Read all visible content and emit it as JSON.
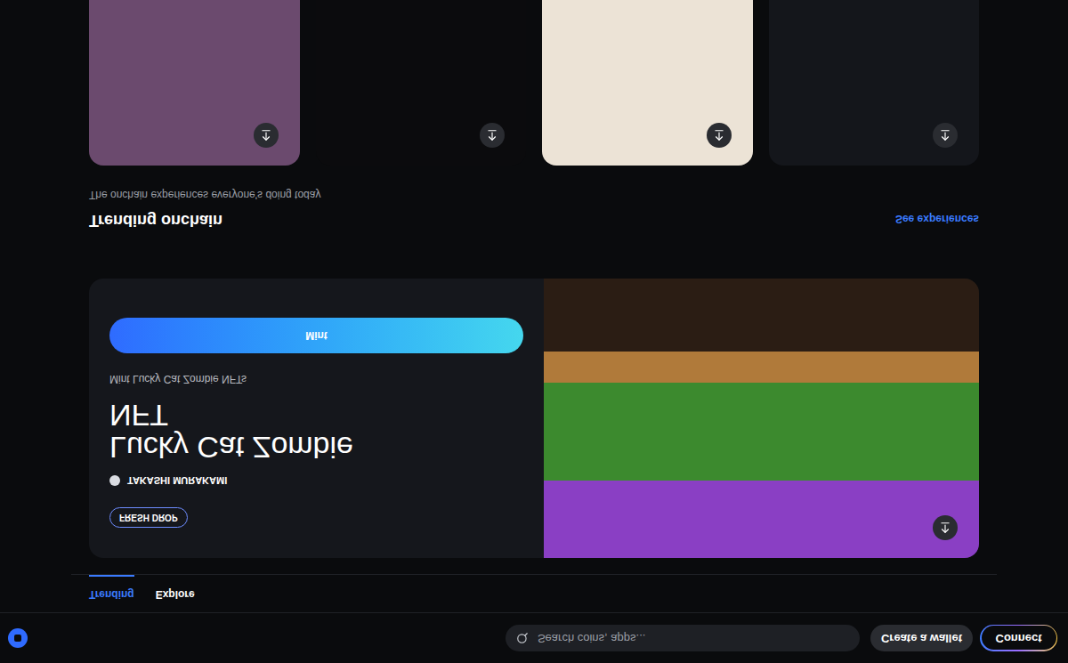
{
  "header": {
    "search_placeholder": "Search coins, apps...",
    "buttons": [
      "Create a wallet",
      "Connect"
    ]
  },
  "tabs": [
    {
      "label": "Trending",
      "selected": true
    },
    {
      "label": "Explore",
      "selected": false
    }
  ],
  "featured": {
    "badge": "FRESH DROP",
    "author": "TAKASHI MURAKAMI",
    "title": "Lucky Cat Zombie NFT",
    "description": "Mint Lucky Cat Zombie NFTs",
    "button": "Mint"
  },
  "section": {
    "title": "Trending onchain",
    "subtitle": "The onchain experiences everyone's doing today",
    "link": "See experiences"
  },
  "cards": [
    {
      "color": "#6b4a6e"
    },
    {
      "color": "#0b0b0d"
    },
    {
      "color": "#ece3d6"
    },
    {
      "color": "#14161b"
    }
  ]
}
